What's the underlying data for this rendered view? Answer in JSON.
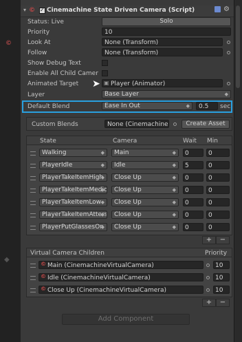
{
  "component": {
    "title": "Cinemachine State Driven Camera (Script)",
    "icons": [
      "script-icon",
      "help-icon",
      "settings-icon"
    ]
  },
  "props": {
    "status_label": "Status: Live",
    "solo_label": "Solo",
    "priority_label": "Priority",
    "priority_value": "10",
    "lookat_label": "Look At",
    "lookat_value": "None (Transform)",
    "follow_label": "Follow",
    "follow_value": "None (Transform)",
    "debug_label": "Show Debug Text",
    "enable_children_label": "Enable All Child Camer",
    "animated_target_label": "Animated Target",
    "animated_target_value": "Player (Animator)",
    "layer_label": "Layer",
    "layer_value": "Base Layer",
    "blend_label": "Default Blend",
    "blend_value": "Ease In Out",
    "blend_time": "0.5",
    "blend_unit": "sec"
  },
  "custom_blends": {
    "label": "Custom Blends",
    "value": "None (Cinemachine",
    "create_label": "Create Asset"
  },
  "states_table": {
    "headers": [
      "State",
      "Camera",
      "Wait",
      "Min"
    ],
    "rows": [
      {
        "state": "Walking",
        "camera": "Main",
        "wait": "0",
        "min": "0"
      },
      {
        "state": "PlayerIdle",
        "camera": "Idle",
        "wait": "5",
        "min": "0"
      },
      {
        "state": "PlayerTakeItemHigh",
        "camera": "Close Up",
        "wait": "0",
        "min": "0"
      },
      {
        "state": "PlayerTakeItemMedio",
        "camera": "Close Up",
        "wait": "0",
        "min": "0"
      },
      {
        "state": "PlayerTakeItemLow",
        "camera": "Close Up",
        "wait": "0",
        "min": "0"
      },
      {
        "state": "PlayerTakeItemAtters",
        "camera": "Close Up",
        "wait": "0",
        "min": "0"
      },
      {
        "state": "PlayerPutGlassesOn",
        "camera": "Close Up",
        "wait": "0",
        "min": "0"
      }
    ],
    "add_label": "+",
    "remove_label": "−"
  },
  "children": {
    "header": "Virtual Camera Children",
    "priority_header": "Priority",
    "rows": [
      {
        "name": "Main (CinemachineVirtualCamera)",
        "priority": "10"
      },
      {
        "name": "Idle (CinemachineVirtualCamera)",
        "priority": "10"
      },
      {
        "name": "Close Up (CinemachineVirtualCamera)",
        "priority": "10"
      }
    ],
    "add_label": "+",
    "remove_label": "−"
  },
  "footer": {
    "add_component_label": "Add Component"
  },
  "colors": {
    "highlight": "#29a0e0",
    "panel": "#3a3a3a",
    "field": "#262626"
  }
}
